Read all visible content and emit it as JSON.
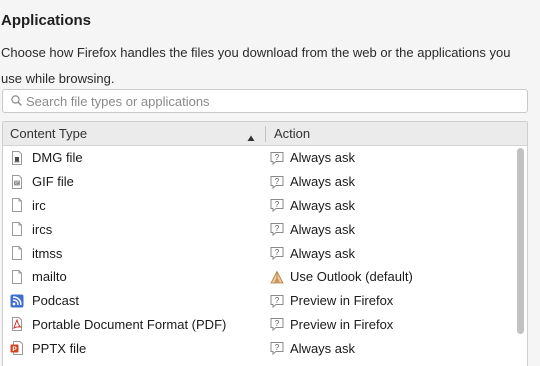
{
  "heading": "Applications",
  "description": "Choose how Firefox handles the files you download from the web or the applications you use while browsing.",
  "search": {
    "placeholder": "Search file types or applications",
    "value": ""
  },
  "table": {
    "columns": {
      "content_type": "Content Type",
      "action": "Action"
    },
    "sort": {
      "column": "content_type",
      "direction": "ascending"
    },
    "rows": [
      {
        "type": "DMG file",
        "type_icon": "dmg-file-icon",
        "action": "Always ask",
        "action_icon": "ask-icon"
      },
      {
        "type": "GIF file",
        "type_icon": "gif-file-icon",
        "action": "Always ask",
        "action_icon": "ask-icon"
      },
      {
        "type": "irc",
        "type_icon": "generic-file-icon",
        "action": "Always ask",
        "action_icon": "ask-icon"
      },
      {
        "type": "ircs",
        "type_icon": "generic-file-icon",
        "action": "Always ask",
        "action_icon": "ask-icon"
      },
      {
        "type": "itmss",
        "type_icon": "generic-file-icon",
        "action": "Always ask",
        "action_icon": "ask-icon"
      },
      {
        "type": "mailto",
        "type_icon": "generic-file-icon",
        "action": "Use Outlook (default)",
        "action_icon": "outlook-icon"
      },
      {
        "type": "Podcast",
        "type_icon": "rss-feed-icon",
        "action": "Preview in Firefox",
        "action_icon": "ask-icon"
      },
      {
        "type": "Portable Document Format (PDF)",
        "type_icon": "pdf-file-icon",
        "action": "Preview in Firefox",
        "action_icon": "ask-icon"
      },
      {
        "type": "PPTX file",
        "type_icon": "pptx-file-icon",
        "action": "Always ask",
        "action_icon": "ask-icon"
      }
    ]
  }
}
